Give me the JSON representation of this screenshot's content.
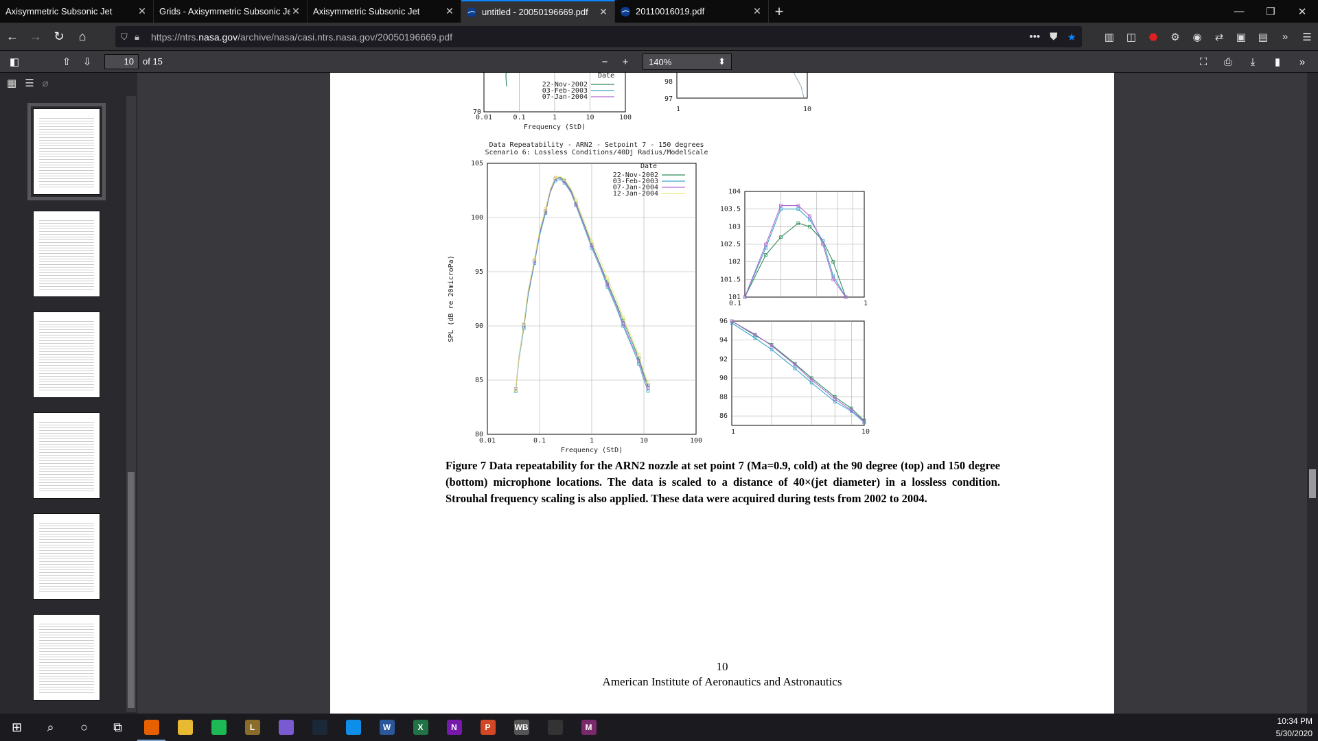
{
  "tabs": [
    {
      "label": "Axisymmetric Subsonic Jet",
      "icon": "page-icon",
      "active": false
    },
    {
      "label": "Grids - Axisymmetric Subsonic Jet",
      "icon": "page-icon",
      "active": false
    },
    {
      "label": "Axisymmetric Subsonic Jet",
      "icon": "page-icon",
      "active": false
    },
    {
      "label": "untitled - 20050196669.pdf",
      "icon": "nasa-icon",
      "active": true
    },
    {
      "label": "20110016019.pdf",
      "icon": "nasa-icon",
      "active": false
    }
  ],
  "url": {
    "prefix": "https://ntrs.",
    "domain": "nasa.gov",
    "suffix": "/archive/nasa/casi.ntrs.nasa.gov/20050196669.pdf"
  },
  "pdf": {
    "page_value": "10",
    "page_total": "of 15",
    "zoom": "140%"
  },
  "page": {
    "caption": "Figure 7 Data repeatability for the ARN2 nozzle at set point 7 (Ma=0.9, cold) at the 90 degree (top) and 150 degree (bottom) microphone locations.  The data is scaled to a distance of 40×(jet diameter) in a lossless condition.  Strouhal frequency scaling is also applied.  These data were acquired during tests from 2002 to 2004.",
    "page_number": "10",
    "footer": "American Institute of Aeronautics and Astronautics"
  },
  "chart_data": [
    {
      "type": "line",
      "title": "",
      "xlabel": "Frequency (StD)",
      "ylabel": "",
      "x_scale": "log",
      "xlim": [
        0.01,
        100
      ],
      "x_ticks": [
        "0.01",
        "0.1",
        "1",
        "10",
        "100"
      ],
      "y_ticks": [
        "70"
      ],
      "legend_title": "Date",
      "legend": [
        "22-Nov-2002",
        "03-Feb-2003",
        "07-Jan-2004"
      ],
      "legend_position": "top-right",
      "grid": true,
      "note": "top chart partially cut off at page top"
    },
    {
      "type": "line",
      "title": "Data Repeatability - ARN2 - Setpoint 7 - 150 degrees",
      "subtitle": "Scenario 6: Lossless Conditions/40Dj Radius/ModelScale",
      "xlabel": "Frequency (StD)",
      "ylabel": "SPL (dB re 20microPa)",
      "x_scale": "log",
      "xlim": [
        0.01,
        100
      ],
      "ylim": [
        80,
        105
      ],
      "x_ticks": [
        "0.01",
        "0.1",
        "1",
        "10",
        "100"
      ],
      "y_ticks": [
        "80",
        "85",
        "90",
        "95",
        "100",
        "105"
      ],
      "legend_title": "Date",
      "legend": [
        "22-Nov-2002",
        "03-Feb-2003",
        "07-Jan-2004",
        "12-Jan-2004"
      ],
      "legend_position": "top-right",
      "grid": true,
      "x": [
        0.035,
        0.04,
        0.05,
        0.06,
        0.08,
        0.1,
        0.13,
        0.16,
        0.2,
        0.25,
        0.3,
        0.4,
        0.5,
        0.7,
        1,
        1.5,
        2,
        3,
        4,
        6,
        8,
        10,
        12
      ],
      "series": [
        {
          "name": "22-Nov-2002",
          "color": "#2e8b57",
          "values": [
            84,
            87,
            90,
            93,
            96,
            98.5,
            100.5,
            102.5,
            103.6,
            103.7,
            103.4,
            102.5,
            101.3,
            99.5,
            97.5,
            95.5,
            94,
            92,
            90.5,
            88.5,
            87,
            85.5,
            84.5
          ]
        },
        {
          "name": "03-Feb-2003",
          "color": "#3aa6c9",
          "values": [
            84,
            86.8,
            89.8,
            92.7,
            95.8,
            98.3,
            100.4,
            102.3,
            103.4,
            103.5,
            103.2,
            102.3,
            101.1,
            99.2,
            97.2,
            95.2,
            93.6,
            91.6,
            90,
            88,
            86.5,
            85,
            84
          ]
        },
        {
          "name": "07-Jan-2004",
          "color": "#b06ad4",
          "values": [
            84.2,
            87.1,
            90.1,
            93,
            96,
            98.6,
            100.6,
            102.4,
            103.6,
            103.6,
            103.3,
            102.4,
            101.2,
            99.4,
            97.4,
            95.4,
            93.8,
            91.8,
            90.2,
            88.2,
            86.8,
            85.3,
            84.3
          ]
        },
        {
          "name": "12-Jan-2004",
          "color": "#e6e67a",
          "values": [
            84.1,
            87,
            90.2,
            93.2,
            96.2,
            98.8,
            100.8,
            102.6,
            103.7,
            103.8,
            103.5,
            102.7,
            101.6,
            99.8,
            97.8,
            95.9,
            94.4,
            92.4,
            90.8,
            88.8,
            87.3,
            85.8,
            84.8
          ]
        }
      ]
    },
    {
      "type": "line",
      "title": "",
      "xlabel": "",
      "ylabel": "",
      "xlim": [
        0.1,
        1
      ],
      "ylim": [
        101,
        104
      ],
      "x_ticks": [
        "0.1",
        "1"
      ],
      "y_ticks": [
        "101",
        "101.5",
        "102",
        "102.5",
        "103",
        "103.5",
        "104"
      ],
      "grid": true,
      "x": [
        0.1,
        0.15,
        0.2,
        0.28,
        0.35,
        0.45,
        0.55,
        0.7
      ],
      "series": [
        {
          "name": "22-Nov-2002",
          "color": "#2e8b57",
          "values": [
            101,
            102.2,
            102.7,
            103.1,
            103.0,
            102.6,
            102.0,
            101.0
          ]
        },
        {
          "name": "03-Feb-2003",
          "color": "#3aa6c9",
          "values": [
            101,
            102.4,
            103.5,
            103.5,
            103.2,
            102.6,
            101.6,
            101.0
          ]
        },
        {
          "name": "07-Jan-2004",
          "color": "#b06ad4",
          "values": [
            101,
            102.5,
            103.6,
            103.6,
            103.3,
            102.5,
            101.5,
            101.0
          ]
        }
      ]
    },
    {
      "type": "line",
      "title": "",
      "xlabel": "",
      "ylabel": "",
      "x_scale": "log",
      "xlim": [
        1,
        10
      ],
      "ylim": [
        85,
        96
      ],
      "x_ticks": [
        "1",
        "10"
      ],
      "y_ticks": [
        "86",
        "88",
        "90",
        "92",
        "94",
        "96"
      ],
      "grid": true,
      "x": [
        1,
        1.5,
        2,
        3,
        4,
        6,
        8,
        10
      ],
      "series": [
        {
          "name": "22-Nov-2002",
          "color": "#2e8b57",
          "values": [
            96,
            94.5,
            93.5,
            91.5,
            90,
            88,
            86.8,
            85.5
          ]
        },
        {
          "name": "03-Feb-2003",
          "color": "#3aa6c9",
          "values": [
            95.8,
            94.2,
            93,
            91,
            89.5,
            87.5,
            86.5,
            85.3
          ]
        },
        {
          "name": "07-Jan-2004",
          "color": "#b06ad4",
          "values": [
            96,
            94.6,
            93.4,
            91.4,
            89.8,
            87.8,
            86.6,
            85.4
          ]
        }
      ]
    }
  ],
  "taskbar": {
    "apps": [
      {
        "name": "windows-start-icon",
        "glyph": "⊞",
        "color": "#1b1b1f"
      },
      {
        "name": "search-icon",
        "glyph": "⌕",
        "color": "#1b1b1f"
      },
      {
        "name": "cortana-icon",
        "glyph": "○",
        "color": "#1b1b1f"
      },
      {
        "name": "task-view-icon",
        "glyph": "⧉",
        "color": "#1b1b1f"
      },
      {
        "name": "firefox-icon",
        "glyph": "",
        "color": "#e66000"
      },
      {
        "name": "file-explorer-icon",
        "glyph": "",
        "color": "#e8b932"
      },
      {
        "name": "spotify-icon",
        "glyph": "",
        "color": "#1db954"
      },
      {
        "name": "league-icon",
        "glyph": "L",
        "color": "#8a6d2b"
      },
      {
        "name": "messenger-icon",
        "glyph": "",
        "color": "#7a5ad0"
      },
      {
        "name": "steam-icon",
        "glyph": "",
        "color": "#1b2838"
      },
      {
        "name": "teamviewer-icon",
        "glyph": "",
        "color": "#0e8ee9"
      },
      {
        "name": "word-icon",
        "glyph": "W",
        "color": "#2b579a"
      },
      {
        "name": "excel-icon",
        "glyph": "X",
        "color": "#217346"
      },
      {
        "name": "onenote-icon",
        "glyph": "N",
        "color": "#7719aa"
      },
      {
        "name": "powerpoint-icon",
        "glyph": "P",
        "color": "#d24726"
      },
      {
        "name": "workbench-icon",
        "glyph": "WB",
        "color": "#555"
      },
      {
        "name": "obs-icon",
        "glyph": "",
        "color": "#333"
      },
      {
        "name": "matlab-icon",
        "glyph": "M",
        "color": "#7a2a6a"
      }
    ],
    "time": "10:34 PM",
    "date": "5/30/2020"
  }
}
